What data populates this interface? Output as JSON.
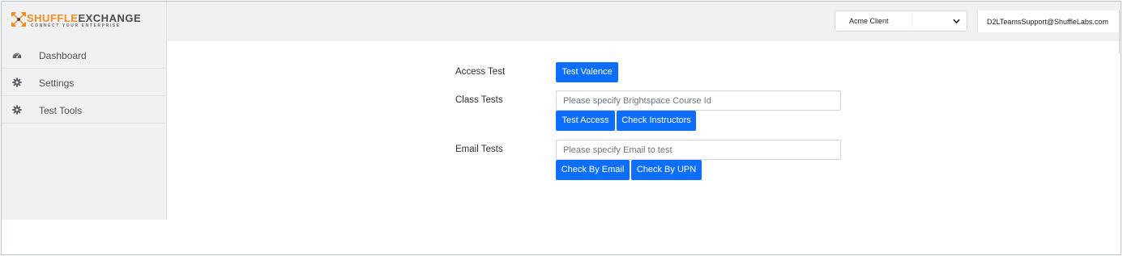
{
  "header": {
    "logo": {
      "brand_part1": "SHUFFLE",
      "brand_part2": "EXCHANGE",
      "tagline": "CONNECT YOUR ENTERPRISE"
    },
    "client_select": {
      "value": "Acme Client",
      "icon": "chevron-down-icon"
    },
    "user_email": "D2LTeamsSupport@ShuffleLabs.com"
  },
  "sidebar": {
    "items": [
      {
        "label": "Dashboard",
        "icon": "dashboard-icon"
      },
      {
        "label": "Settings",
        "icon": "gear-icon"
      },
      {
        "label": "Test Tools",
        "icon": "gear-icon"
      }
    ]
  },
  "main": {
    "access_test": {
      "label": "Access Test",
      "button": "Test Valence"
    },
    "class_tests": {
      "label": "Class Tests",
      "input_placeholder": "Please specify Brightspace Course Id",
      "input_value": "",
      "buttons": [
        "Test Access",
        "Check Instructors"
      ]
    },
    "email_tests": {
      "label": "Email Tests",
      "input_placeholder": "Please specify Email to test",
      "input_value": "",
      "buttons": [
        "Check By Email",
        "Check By UPN"
      ]
    }
  },
  "colors": {
    "primary_button": "#0d6efd",
    "brand_orange": "#f28a1c",
    "chrome_gray": "#f0f1f3"
  }
}
